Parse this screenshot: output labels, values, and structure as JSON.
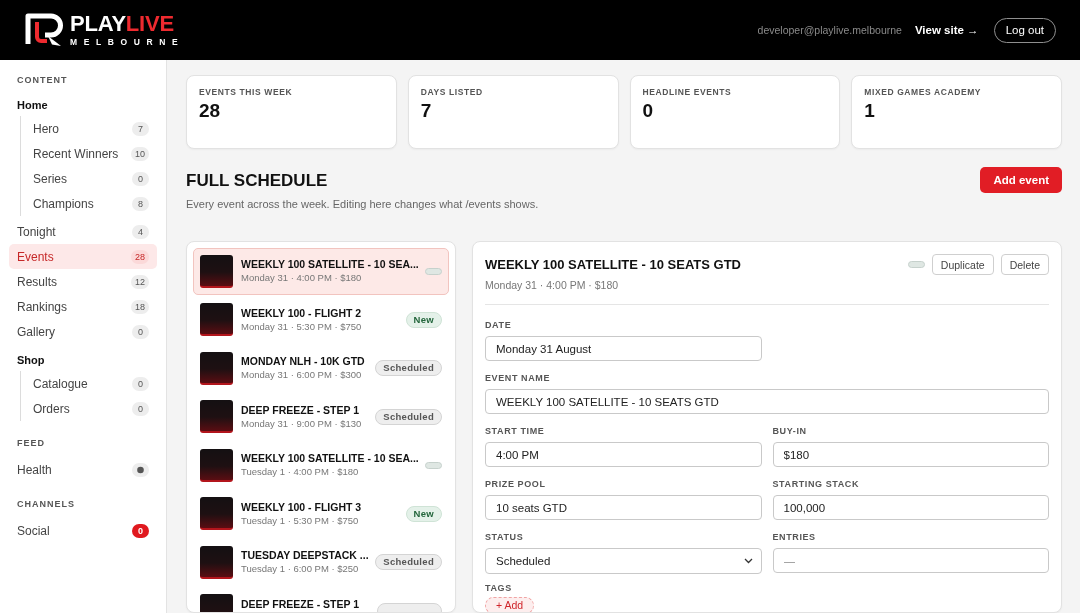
{
  "header": {
    "brand": {
      "name_parts": [
        "PLAY",
        "LIVE"
      ],
      "tagline": "MELBOURNE"
    },
    "user_email": "developer@playlive.melbourne",
    "view_site": "View site →",
    "logout": "Log out"
  },
  "sidebar": {
    "sections": [
      {
        "label": "CONTENT",
        "items": [
          {
            "kind": "group",
            "label": "Home",
            "selected": false,
            "children": [
              {
                "kind": "link",
                "label": "Hero",
                "count": "7",
                "selected": false
              },
              {
                "kind": "link",
                "label": "Recent Winners",
                "count": "10",
                "selected": false
              },
              {
                "kind": "link",
                "label": "Series",
                "count": "0",
                "selected": false
              },
              {
                "kind": "link",
                "label": "Champions",
                "count": "8",
                "selected": false
              }
            ]
          },
          {
            "kind": "link",
            "label": "Tonight",
            "count": "4",
            "selected": false
          },
          {
            "kind": "link",
            "label": "Events",
            "count": "28",
            "selected": true
          },
          {
            "kind": "link",
            "label": "Results",
            "count": "12",
            "selected": false
          },
          {
            "kind": "link",
            "label": "Rankings",
            "count": "18",
            "selected": false
          },
          {
            "kind": "link",
            "label": "Gallery",
            "count": "0",
            "selected": false
          },
          {
            "kind": "group",
            "label": "Shop",
            "selected": false,
            "children": [
              {
                "kind": "link",
                "label": "Catalogue",
                "count": "0",
                "selected": false
              },
              {
                "kind": "link",
                "label": "Orders",
                "count": "0",
                "selected": false
              }
            ]
          }
        ]
      },
      {
        "label": "FEED",
        "items": [
          {
            "kind": "status",
            "label": "Health",
            "selected": false
          }
        ]
      },
      {
        "label": "CHANNELS",
        "items": [
          {
            "kind": "alert",
            "label": "Social",
            "count": "0",
            "selected": false
          }
        ]
      }
    ]
  },
  "stats": [
    {
      "label": "EVENTS THIS WEEK",
      "value": "28"
    },
    {
      "label": "DAYS LISTED",
      "value": "7"
    },
    {
      "label": "HEADLINE EVENTS",
      "value": "0"
    },
    {
      "label": "MIXED GAMES ACADEMY",
      "value": "1"
    }
  ],
  "schedule": {
    "title": "FULL SCHEDULE",
    "subtitle": "Every event across the week. Editing here changes what /events shows.",
    "add_button": "Add event"
  },
  "events": [
    {
      "title": "WEEKLY 100 SATELLITE - 10 SEA...",
      "meta": "Monday 31 · 4:00 PM · $180",
      "badge": {
        "kind": "empty"
      },
      "selected": true
    },
    {
      "title": "WEEKLY 100 - FLIGHT 2",
      "meta": "Monday 31 · 5:30 PM · $750",
      "badge": {
        "kind": "new",
        "label": "New"
      },
      "selected": false
    },
    {
      "title": "MONDAY NLH - 10K GTD",
      "meta": "Monday 31 · 6:00 PM · $300",
      "badge": {
        "kind": "scheduled",
        "label": "Scheduled"
      },
      "selected": false
    },
    {
      "title": "DEEP FREEZE - STEP 1",
      "meta": "Monday 31 · 9:00 PM · $130",
      "badge": {
        "kind": "scheduled",
        "label": "Scheduled"
      },
      "selected": false
    },
    {
      "title": "WEEKLY 100 SATELLITE - 10 SEA...",
      "meta": "Tuesday 1 · 4:00 PM · $180",
      "badge": {
        "kind": "empty"
      },
      "selected": false
    },
    {
      "title": "WEEKLY 100 - FLIGHT 3",
      "meta": "Tuesday 1 · 5:30 PM · $750",
      "badge": {
        "kind": "new",
        "label": "New"
      },
      "selected": false
    },
    {
      "title": "TUESDAY DEEPSTACK ...",
      "meta": "Tuesday 1 · 6:00 PM · $250",
      "badge": {
        "kind": "scheduled",
        "label": "Scheduled"
      },
      "selected": false
    },
    {
      "title": "DEEP FREEZE - STEP 1",
      "badge": {
        "kind": "scheduled"
      },
      "selected": false
    }
  ],
  "detail": {
    "title": "WEEKLY 100 SATELLITE - 10 SEATS GTD",
    "meta": "Monday 31 · 4:00 PM · $180",
    "badge": {
      "kind": "empty"
    },
    "actions": [
      "Duplicate",
      "Delete"
    ],
    "fields": [
      {
        "label": "DATE",
        "kind": "text",
        "wide": false,
        "value": "Monday 31 August"
      },
      {
        "label": "EVENT NAME",
        "kind": "text",
        "wide": true,
        "value": "WEEKLY 100 SATELLITE - 10 SEATS GTD"
      },
      {
        "label": "START TIME",
        "kind": "text",
        "wide": false,
        "value": "4:00 PM"
      },
      {
        "label": "BUY-IN",
        "kind": "text",
        "wide": false,
        "value": "$180"
      },
      {
        "label": "PRIZE POOL",
        "kind": "text",
        "wide": false,
        "value": "10 seats GTD"
      },
      {
        "label": "STARTING STACK",
        "kind": "text",
        "wide": false,
        "value": "100,000"
      },
      {
        "label": "STATUS",
        "kind": "select",
        "wide": false,
        "value": "Scheduled"
      },
      {
        "label": "ENTRIES",
        "kind": "text",
        "wide": false,
        "placeholder": "—"
      }
    ],
    "tags": {
      "label": "TAGS",
      "add_button": "+ Add"
    }
  }
}
